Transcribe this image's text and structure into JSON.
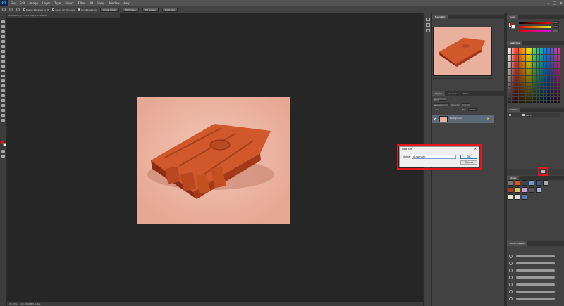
{
  "app": {
    "logo": "Ps"
  },
  "menu": [
    "File",
    "Edit",
    "Image",
    "Layer",
    "Type",
    "Select",
    "Filter",
    "3D",
    "View",
    "Window",
    "Help"
  ],
  "window_controls": {
    "minimize": "–",
    "maximize": "□",
    "close": "✕"
  },
  "options_bar": {
    "resize_windows_label": "Resize Windows to Fit",
    "zoom_all_windows_label": "Zoom All Windows",
    "scrubby_zoom_label": "Scrubby Zoom",
    "actual_pixels_label": "Actual Pixels",
    "fit_screen_label": "Fit Screen",
    "fill_screen_label": "Fill Screen",
    "print_size_label": "Print Size"
  },
  "document_tab": {
    "title": "Untitled-1 @ 33.3% (Layer 1, RGB/8) *"
  },
  "panels": {
    "navigator": {
      "tab": "Navigator"
    },
    "layers": {
      "tabs": [
        "Layers",
        "Channels",
        "Paths"
      ],
      "kind_label": "Kind",
      "blend_mode": "Normal",
      "opacity_label": "Opacity:",
      "lock_label": "Lock:",
      "fill_label": "Fill:",
      "layer_name": "Background",
      "lock_icon": "🔒"
    },
    "color": {
      "tab": "Color"
    },
    "swatches": {
      "tab": "Swatches"
    },
    "actions": {
      "tab": "Actions",
      "set_name": "Set 1"
    },
    "styles": {
      "tab": "Styles"
    },
    "brush_presets": {
      "tab": "Brush Presets",
      "size_label": "Size:"
    }
  },
  "status_bar": {
    "zoom": "33.33%",
    "doc": "Doc: 3.00M/0 bytes"
  },
  "dialog": {
    "title": "New Set",
    "close": "✕",
    "name_label": "Name:",
    "name_value": "Automate",
    "ok_label": "OK",
    "cancel_label": "Cancel"
  },
  "colors": {
    "foreground": "#e01010",
    "background": "#ffffff",
    "canvas": "#e9b19d",
    "highlight": "#e3141d"
  }
}
